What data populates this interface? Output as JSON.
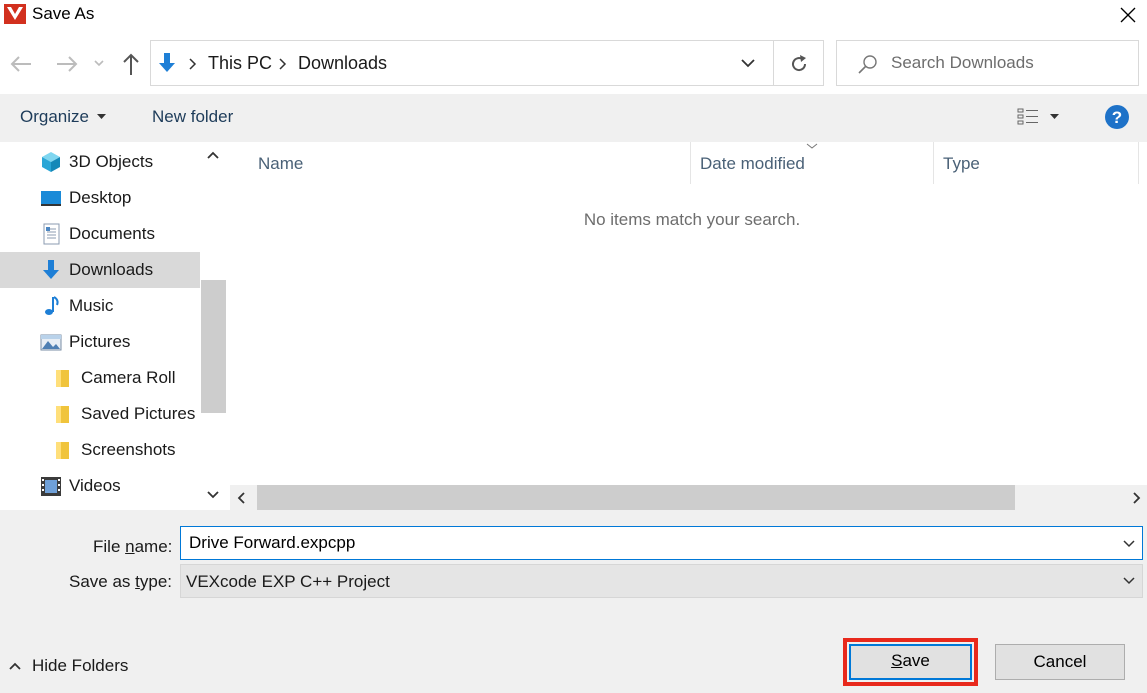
{
  "window": {
    "title": "Save As",
    "close_glyph": "✕"
  },
  "address": {
    "segments": [
      "This PC",
      "Downloads"
    ],
    "search_placeholder": "Search Downloads"
  },
  "toolbar": {
    "organize_label": "Organize",
    "new_folder_label": "New folder",
    "help_glyph": "?"
  },
  "nav_pane": {
    "items": [
      {
        "label": "3D Objects",
        "icon": "3d-objects-icon",
        "level": 0,
        "selected": false
      },
      {
        "label": "Desktop",
        "icon": "desktop-icon",
        "level": 0,
        "selected": false
      },
      {
        "label": "Documents",
        "icon": "documents-icon",
        "level": 0,
        "selected": false
      },
      {
        "label": "Downloads",
        "icon": "downloads-icon",
        "level": 0,
        "selected": true
      },
      {
        "label": "Music",
        "icon": "music-icon",
        "level": 0,
        "selected": false
      },
      {
        "label": "Pictures",
        "icon": "pictures-icon",
        "level": 0,
        "selected": false
      },
      {
        "label": "Camera Roll",
        "icon": "folder-icon",
        "level": 1,
        "selected": false
      },
      {
        "label": "Saved Pictures",
        "icon": "folder-icon",
        "level": 1,
        "selected": false
      },
      {
        "label": "Screenshots",
        "icon": "folder-icon",
        "level": 1,
        "selected": false
      },
      {
        "label": "Videos",
        "icon": "videos-icon",
        "level": 0,
        "selected": false
      }
    ]
  },
  "file_list": {
    "columns": [
      "Name",
      "Date modified",
      "Type"
    ],
    "empty_message": "No items match your search."
  },
  "form": {
    "filename_label_pre": "File ",
    "filename_label_accel": "n",
    "filename_label_post": "ame:",
    "filename_value": "Drive Forward.expcpp",
    "savetype_label_pre": "Save as ",
    "savetype_label_accel": "t",
    "savetype_label_post": "ype:",
    "savetype_value": "VEXcode EXP C++ Project"
  },
  "footer": {
    "hide_folders_label": "Hide Folders",
    "save_accel": "S",
    "save_rest": "ave",
    "cancel_label": "Cancel"
  },
  "colors": {
    "accent": "#0078d7",
    "highlight_border": "#e8291c",
    "toolbar_bg": "#f0f0f0"
  }
}
